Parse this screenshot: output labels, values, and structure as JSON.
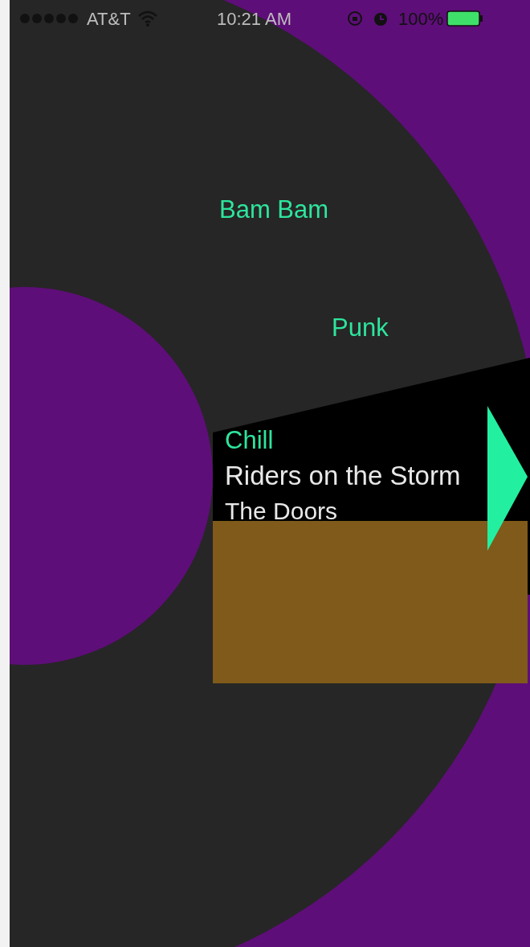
{
  "status_bar": {
    "carrier": "AT&T",
    "time": "10:21 AM",
    "battery": "100%"
  },
  "wheel": {
    "genres": [
      {
        "label": "Bam Bam"
      },
      {
        "label": "Punk"
      }
    ],
    "now_playing": {
      "genre": "Chill",
      "title": "Riders on the Storm",
      "artist": "The Doors"
    }
  }
}
